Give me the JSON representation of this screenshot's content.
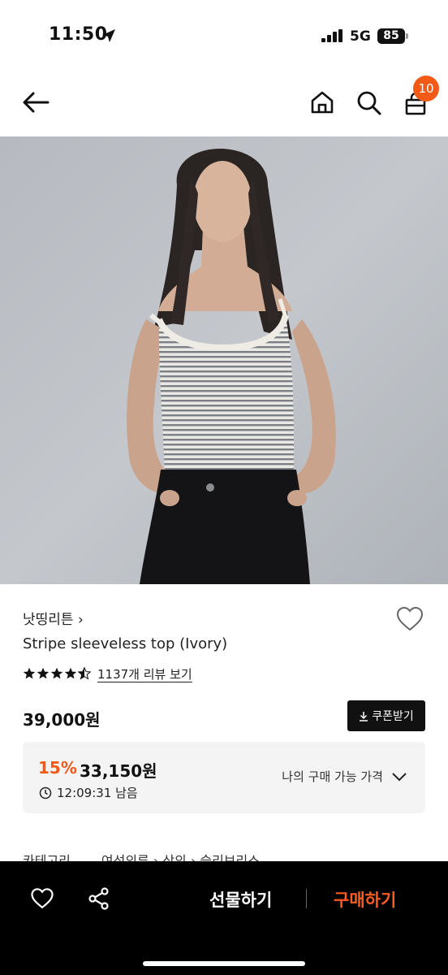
{
  "status_bar": {
    "time": "11:50",
    "network": "5G",
    "battery": "85"
  },
  "header": {
    "cart_count": "10",
    "icons": [
      "back-arrow-icon",
      "home-icon",
      "search-icon",
      "shopping-bag-icon"
    ]
  },
  "product": {
    "brand": "낫띵리튼 ›",
    "name": "Stripe sleeveless top (Ivory)",
    "rating": 4.5,
    "review_link": "1137개 리뷰 보기",
    "price": "39,000원",
    "coupon_label": "쿠폰받기"
  },
  "benefit": {
    "discount": "15%",
    "discounted_price": "33,150원",
    "timer": "12:09:31 남음",
    "my_price_label": "나의 구매 가능 가격"
  },
  "category": {
    "label": "카테고리",
    "path": "여성의류 › 상의 › 슬리브리스"
  },
  "bottom_bar": {
    "gift_label": "선물하기",
    "buy_label": "구매하기"
  },
  "colors": {
    "accent": "#f25a16",
    "buy": "#ff5a1f",
    "bar": "#000000"
  }
}
